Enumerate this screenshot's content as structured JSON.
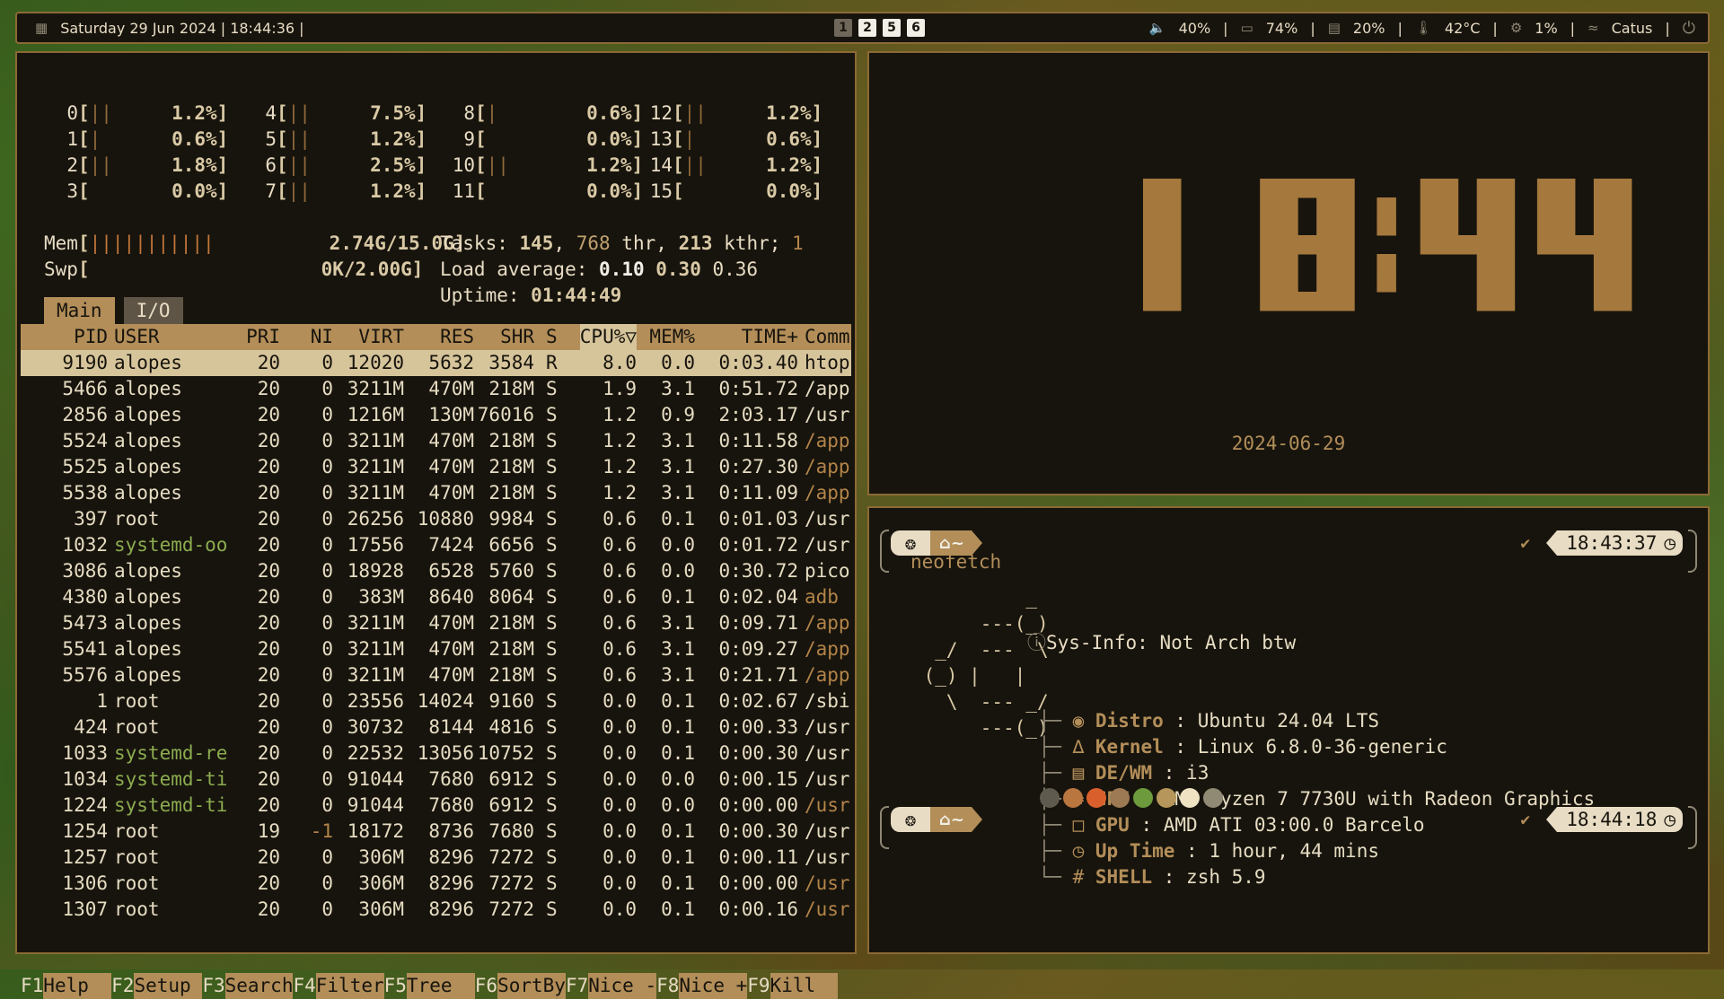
{
  "topbar": {
    "datetime": "Saturday 29 Jun 2024 | 18:44:36 |",
    "workspaces": [
      {
        "label": "1",
        "active": false
      },
      {
        "label": "2",
        "active": true
      },
      {
        "label": "5",
        "active": true
      },
      {
        "label": "6",
        "active": true
      }
    ],
    "volume": "40%",
    "battery": "74%",
    "memory": "20%",
    "temp": "42°C",
    "cpu": "1%",
    "wifi": "Catus",
    "icons": [
      "calendar-icon",
      "volume-icon",
      "battery-icon",
      "memory-icon",
      "thermometer-icon",
      "cpu-icon",
      "wifi-icon",
      "power-icon"
    ]
  },
  "htop": {
    "cpus": [
      {
        "id": "0",
        "bar": "||",
        "pct": "1.2%"
      },
      {
        "id": "1",
        "bar": "|",
        "pct": "0.6%"
      },
      {
        "id": "2",
        "bar": "||",
        "pct": "1.8%"
      },
      {
        "id": "3",
        "bar": "",
        "pct": "0.0%"
      },
      {
        "id": "4",
        "bar": "||",
        "pct": "7.5%"
      },
      {
        "id": "5",
        "bar": "||",
        "pct": "1.2%"
      },
      {
        "id": "6",
        "bar": "||",
        "pct": "2.5%"
      },
      {
        "id": "7",
        "bar": "||",
        "pct": "1.2%"
      },
      {
        "id": "8",
        "bar": "|",
        "pct": "0.6%"
      },
      {
        "id": "9",
        "bar": "",
        "pct": "0.0%"
      },
      {
        "id": "10",
        "bar": "||",
        "pct": "1.2%"
      },
      {
        "id": "11",
        "bar": "",
        "pct": "0.0%"
      },
      {
        "id": "12",
        "bar": "||",
        "pct": "1.2%"
      },
      {
        "id": "13",
        "bar": "|",
        "pct": "0.6%"
      },
      {
        "id": "14",
        "bar": "||",
        "pct": "1.2%"
      },
      {
        "id": "15",
        "bar": "",
        "pct": "0.0%"
      }
    ],
    "mem_label": "Mem",
    "mem_bar": "|||||||||||",
    "mem_value": "2.74G/15.0G",
    "swp_label": "Swp",
    "swp_value": "0K/2.00G",
    "tasks_label": "Tasks:",
    "tasks": "145",
    "threads": "768",
    "thr_label": "thr,",
    "kthreads": "213",
    "kthr_label": "kthr;",
    "running": "1",
    "load_label": "Load average:",
    "load1": "0.10",
    "load5": "0.30",
    "load15": "0.36",
    "uptime_label": "Uptime:",
    "uptime": "01:44:49",
    "tabs": [
      "Main",
      "I/O"
    ],
    "columns": {
      "pid": "PID",
      "user": "USER",
      "pri": "PRI",
      "ni": "NI",
      "virt": "VIRT",
      "res": "RES",
      "shr": "SHR",
      "s": "S",
      "cpu": "CPU%▽",
      "mem": "MEM%",
      "time": "TIME+",
      "cmd": "Comm"
    },
    "processes": [
      {
        "pid": "9190",
        "user": "alopes",
        "pri": "20",
        "ni": "0",
        "virt": "12020",
        "res": "5632",
        "shr": "3584",
        "s": "R",
        "cpu": "8.0",
        "mem": "0.0",
        "time": "0:03.40",
        "cmd": "htop",
        "selected": true
      },
      {
        "pid": "5466",
        "user": "alopes",
        "pri": "20",
        "ni": "0",
        "virt": "3211M",
        "res": "470M",
        "shr": "218M",
        "s": "S",
        "cpu": "1.9",
        "mem": "3.1",
        "time": "0:51.72",
        "cmd": "/app"
      },
      {
        "pid": "2856",
        "user": "alopes",
        "pri": "20",
        "ni": "0",
        "virt": "1216M",
        "res": "130M",
        "shr": "76016",
        "s": "S",
        "cpu": "1.2",
        "mem": "0.9",
        "time": "2:03.17",
        "cmd": "/usr"
      },
      {
        "pid": "5524",
        "user": "alopes",
        "pri": "20",
        "ni": "0",
        "virt": "3211M",
        "res": "470M",
        "shr": "218M",
        "s": "S",
        "cpu": "1.2",
        "mem": "3.1",
        "time": "0:11.58",
        "cmd": "/app",
        "thread": true
      },
      {
        "pid": "5525",
        "user": "alopes",
        "pri": "20",
        "ni": "0",
        "virt": "3211M",
        "res": "470M",
        "shr": "218M",
        "s": "S",
        "cpu": "1.2",
        "mem": "3.1",
        "time": "0:27.30",
        "cmd": "/app",
        "thread": true
      },
      {
        "pid": "5538",
        "user": "alopes",
        "pri": "20",
        "ni": "0",
        "virt": "3211M",
        "res": "470M",
        "shr": "218M",
        "s": "S",
        "cpu": "1.2",
        "mem": "3.1",
        "time": "0:11.09",
        "cmd": "/app",
        "thread": true
      },
      {
        "pid": "397",
        "user": "root",
        "pri": "20",
        "ni": "0",
        "virt": "26256",
        "res": "10880",
        "shr": "9984",
        "s": "S",
        "cpu": "0.6",
        "mem": "0.1",
        "time": "0:01.03",
        "cmd": "/usr"
      },
      {
        "pid": "1032",
        "user": "systemd-oo",
        "pri": "20",
        "ni": "0",
        "virt": "17556",
        "res": "7424",
        "shr": "6656",
        "s": "S",
        "cpu": "0.6",
        "mem": "0.0",
        "time": "0:01.72",
        "cmd": "/usr",
        "sys": true
      },
      {
        "pid": "3086",
        "user": "alopes",
        "pri": "20",
        "ni": "0",
        "virt": "18928",
        "res": "6528",
        "shr": "5760",
        "s": "S",
        "cpu": "0.6",
        "mem": "0.0",
        "time": "0:30.72",
        "cmd": "pico"
      },
      {
        "pid": "4380",
        "user": "alopes",
        "pri": "20",
        "ni": "0",
        "virt": "383M",
        "res": "8640",
        "shr": "8064",
        "s": "S",
        "cpu": "0.6",
        "mem": "0.1",
        "time": "0:02.04",
        "cmd": "adb",
        "thread": true
      },
      {
        "pid": "5473",
        "user": "alopes",
        "pri": "20",
        "ni": "0",
        "virt": "3211M",
        "res": "470M",
        "shr": "218M",
        "s": "S",
        "cpu": "0.6",
        "mem": "3.1",
        "time": "0:09.71",
        "cmd": "/app",
        "thread": true
      },
      {
        "pid": "5541",
        "user": "alopes",
        "pri": "20",
        "ni": "0",
        "virt": "3211M",
        "res": "470M",
        "shr": "218M",
        "s": "S",
        "cpu": "0.6",
        "mem": "3.1",
        "time": "0:09.27",
        "cmd": "/app",
        "thread": true
      },
      {
        "pid": "5576",
        "user": "alopes",
        "pri": "20",
        "ni": "0",
        "virt": "3211M",
        "res": "470M",
        "shr": "218M",
        "s": "S",
        "cpu": "0.6",
        "mem": "3.1",
        "time": "0:21.71",
        "cmd": "/app",
        "thread": true
      },
      {
        "pid": "1",
        "user": "root",
        "pri": "20",
        "ni": "0",
        "virt": "23556",
        "res": "14024",
        "shr": "9160",
        "s": "S",
        "cpu": "0.0",
        "mem": "0.1",
        "time": "0:02.67",
        "cmd": "/sbi"
      },
      {
        "pid": "424",
        "user": "root",
        "pri": "20",
        "ni": "0",
        "virt": "30732",
        "res": "8144",
        "shr": "4816",
        "s": "S",
        "cpu": "0.0",
        "mem": "0.1",
        "time": "0:00.33",
        "cmd": "/usr"
      },
      {
        "pid": "1033",
        "user": "systemd-re",
        "pri": "20",
        "ni": "0",
        "virt": "22532",
        "res": "13056",
        "shr": "10752",
        "s": "S",
        "cpu": "0.0",
        "mem": "0.1",
        "time": "0:00.30",
        "cmd": "/usr",
        "sys": true
      },
      {
        "pid": "1034",
        "user": "systemd-ti",
        "pri": "20",
        "ni": "0",
        "virt": "91044",
        "res": "7680",
        "shr": "6912",
        "s": "S",
        "cpu": "0.0",
        "mem": "0.0",
        "time": "0:00.15",
        "cmd": "/usr",
        "sys": true
      },
      {
        "pid": "1224",
        "user": "systemd-ti",
        "pri": "20",
        "ni": "0",
        "virt": "91044",
        "res": "7680",
        "shr": "6912",
        "s": "S",
        "cpu": "0.0",
        "mem": "0.0",
        "time": "0:00.00",
        "cmd": "/usr",
        "sys": true,
        "thread": true
      },
      {
        "pid": "1254",
        "user": "root",
        "pri": "19",
        "ni": "-1",
        "virt": "18172",
        "res": "8736",
        "shr": "7680",
        "s": "S",
        "cpu": "0.0",
        "mem": "0.1",
        "time": "0:00.30",
        "cmd": "/usr"
      },
      {
        "pid": "1257",
        "user": "root",
        "pri": "20",
        "ni": "0",
        "virt": "306M",
        "res": "8296",
        "shr": "7272",
        "s": "S",
        "cpu": "0.0",
        "mem": "0.1",
        "time": "0:00.11",
        "cmd": "/usr"
      },
      {
        "pid": "1306",
        "user": "root",
        "pri": "20",
        "ni": "0",
        "virt": "306M",
        "res": "8296",
        "shr": "7272",
        "s": "S",
        "cpu": "0.0",
        "mem": "0.1",
        "time": "0:00.00",
        "cmd": "/usr",
        "thread": true
      },
      {
        "pid": "1307",
        "user": "root",
        "pri": "20",
        "ni": "0",
        "virt": "306M",
        "res": "8296",
        "shr": "7272",
        "s": "S",
        "cpu": "0.0",
        "mem": "0.1",
        "time": "0:00.16",
        "cmd": "/usr",
        "thread": true
      }
    ],
    "fkeys": [
      {
        "key": "F1",
        "label": "Help  "
      },
      {
        "key": "F2",
        "label": "Setup "
      },
      {
        "key": "F3",
        "label": "Search"
      },
      {
        "key": "F4",
        "label": "Filter"
      },
      {
        "key": "F5",
        "label": "Tree  "
      },
      {
        "key": "F6",
        "label": "SortBy"
      },
      {
        "key": "F7",
        "label": "Nice -"
      },
      {
        "key": "F8",
        "label": "Nice +"
      },
      {
        "key": "F9",
        "label": "Kill  "
      }
    ]
  },
  "clock": {
    "time": "18:44",
    "date": "2024-06-29",
    "color": "#a5783d"
  },
  "terminal": {
    "dir": "~",
    "prompt1_time": "18:43:37",
    "prompt2_time": "18:44:18",
    "command": "neofetch",
    "ascii": [
      "             _",
      "         ---(_)",
      "     _/  ---  \\",
      "    (_) |   |",
      "      \\  --- _/",
      "         ---(_)"
    ],
    "sysinfo_label": "Sys-Info:",
    "sysinfo_value": "Not Arch btw",
    "items": [
      {
        "label": "Distro",
        "value": "Ubuntu 24.04 LTS",
        "icon": "ubuntu-icon"
      },
      {
        "label": "Kernel",
        "value": "Linux 6.8.0-36-generic",
        "icon": "linux-icon"
      },
      {
        "label": "DE/WM",
        "value": "i3",
        "icon": "window-icon"
      },
      {
        "label": "CPU",
        "value": "AMD Ryzen 7 7730U with Radeon Graphics",
        "icon": "cpu-icon"
      },
      {
        "label": "GPU",
        "value": "AMD ATI 03:00.0 Barcelo",
        "icon": "monitor-icon"
      },
      {
        "label": "Up Time",
        "value": "1 hour, 44 mins",
        "icon": "clock-icon"
      },
      {
        "label": "SHELL",
        "value": "zsh 5.9",
        "icon": "hash-icon"
      }
    ],
    "palette": [
      "#5f5a4e",
      "#b9763f",
      "#d9602c",
      "#9d7a54",
      "#6d9a3c",
      "#b6965a",
      "#eee2c2",
      "#908a74"
    ]
  }
}
